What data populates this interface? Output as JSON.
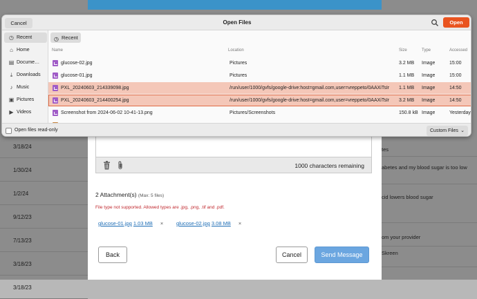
{
  "background": {
    "dates": [
      "3/18/24",
      "1/30/24",
      "1/2/24",
      "9/12/23",
      "7/13/23",
      "3/18/23",
      "3/18/23"
    ]
  },
  "modal_snippets": [
    "tes",
    "abetes and my blood sugar is too low",
    "cid lowers blood sugar",
    "om your provider",
    "Skreen"
  ],
  "compose": {
    "chars_remaining": "1000 characters remaining",
    "attachments_heading": "2 Attachment(s)",
    "attachments_max": "(Max: 5 files)",
    "error": "File type not supported. Allowed types are .jpg, .png, .tif and .pdf.",
    "attachments": [
      {
        "name": "glucose-01.jpg",
        "size": "1.03 MB",
        "remove": "×"
      },
      {
        "name": "glucose-02.jpg",
        "size": "3.08 MB",
        "remove": "×"
      }
    ],
    "back_label": "Back",
    "cancel_label": "Cancel",
    "send_label": "Send Message"
  },
  "dialog": {
    "cancel_label": "Cancel",
    "title": "Open Files",
    "open_label": "Open",
    "pathbar_label": "Recent",
    "sidebar": [
      {
        "label": "Recent",
        "icon": "clock-icon"
      },
      {
        "label": "Home",
        "icon": "home-icon"
      },
      {
        "label": "Docume…",
        "icon": "documents-icon"
      },
      {
        "label": "Downloads",
        "icon": "download-icon"
      },
      {
        "label": "Music",
        "icon": "music-icon"
      },
      {
        "label": "Pictures",
        "icon": "pictures-icon"
      },
      {
        "label": "Videos",
        "icon": "videos-icon"
      }
    ],
    "columns": {
      "name": "Name",
      "location": "Location",
      "size": "Size",
      "type": "Type",
      "accessed": "Accessed"
    },
    "files": [
      {
        "name": "glucose-02.jpg",
        "location": "Pictures",
        "size": "3.2 MB",
        "type": "Image",
        "accessed": "15:00",
        "state": "normal"
      },
      {
        "name": "glucose-01.jpg",
        "location": "Pictures",
        "size": "1.1 MB",
        "type": "Image",
        "accessed": "15:00",
        "state": "normal"
      },
      {
        "name": "PXL_20240603_214339098.jpg",
        "location": "/run/user/1000/gvfs/google-drive:host=gmail.com,user=vreppeto/0AAXiTsIr",
        "size": "1.1 MB",
        "type": "Image",
        "accessed": "14:50",
        "state": "selected"
      },
      {
        "name": "PXL_20240603_214400254.jpg",
        "location": "/run/user/1000/gvfs/google-drive:host=gmail.com,user=vreppeto/0AAXiTsIr",
        "size": "3.2 MB",
        "type": "Image",
        "accessed": "14:50",
        "state": "focused"
      },
      {
        "name": "Screenshot from 2024-06-02 10-41-13.png",
        "location": "Pictures/Screenshots",
        "size": "150.8 kB",
        "type": "Image",
        "accessed": "Yesterday",
        "state": "normal"
      }
    ],
    "read_only_label": "Open files read-only",
    "filter_label": "Custom Files"
  }
}
